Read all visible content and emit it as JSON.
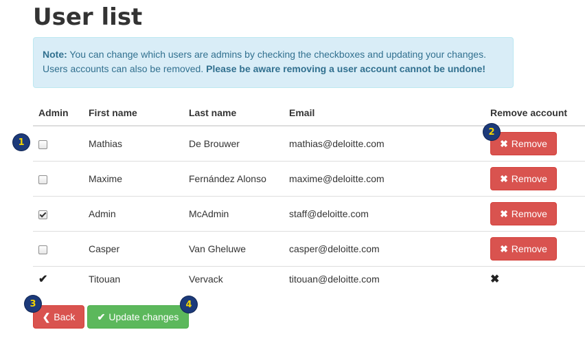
{
  "page": {
    "title": "User list"
  },
  "note": {
    "label": "Note:",
    "text": " You can change which users are admins by checking the checkboxes and updating your changes. Users accounts can also be removed. ",
    "warning": "Please be aware removing a user account cannot be undone!"
  },
  "table": {
    "headers": {
      "admin": "Admin",
      "first_name": "First name",
      "last_name": "Last name",
      "email": "Email",
      "remove": "Remove account"
    },
    "rows": [
      {
        "admin": false,
        "first_name": "Mathias",
        "last_name": "De Brouwer",
        "email": "mathias@deloitte.com",
        "remove_label": "Remove"
      },
      {
        "admin": false,
        "first_name": "Maxime",
        "last_name": "Fernández Alonso",
        "email": "maxime@deloitte.com",
        "remove_label": "Remove"
      },
      {
        "admin": true,
        "first_name": "Admin",
        "last_name": "McAdmin",
        "email": "staff@deloitte.com",
        "remove_label": "Remove"
      },
      {
        "admin": false,
        "first_name": "Casper",
        "last_name": "Van Gheluwe",
        "email": "casper@deloitte.com",
        "remove_label": "Remove"
      }
    ],
    "current_user": {
      "admin_glyph": "✔",
      "first_name": "Titouan",
      "last_name": "Vervack",
      "email": "titouan@deloitte.com",
      "remove_glyph": "✖"
    }
  },
  "icons": {
    "remove": "✖",
    "back": "❮",
    "update": "✔"
  },
  "actions": {
    "back_label": "Back",
    "update_label": "Update changes"
  },
  "markers": [
    "1",
    "2",
    "3",
    "4"
  ],
  "colors": {
    "danger": "#d9534f",
    "success": "#5cb85c",
    "info_bg": "#d9edf7",
    "info_text": "#31708f",
    "marker_bg": "#1c3a7a",
    "marker_text": "#f2d400"
  }
}
